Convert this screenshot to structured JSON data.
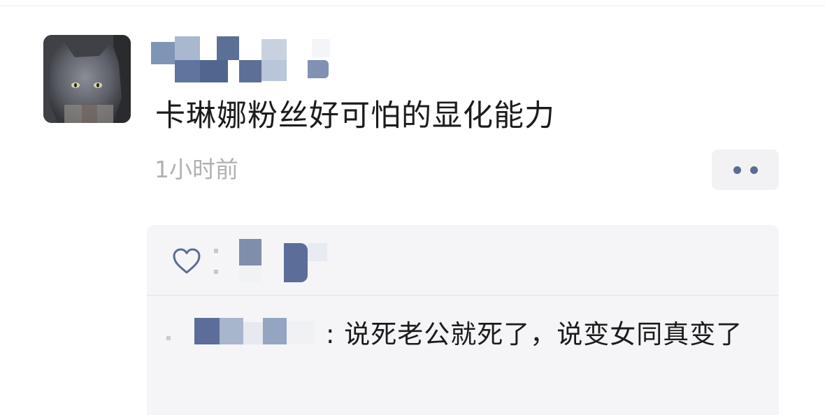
{
  "post": {
    "author_name": "",
    "text": "卡琳娜粉丝好可怕的显化能力",
    "timestamp": "1小时前"
  },
  "more_button": {
    "icon": "more-dots-icon"
  },
  "interactions": {
    "like_icon": "heart-outline-icon",
    "comments": [
      {
        "author": "",
        "separator": ":",
        "text": "说死老公就死了，说变女同真变了"
      }
    ]
  },
  "colors": {
    "text_primary": "#1b1b1b",
    "text_secondary": "#b1b1b1",
    "link_blue": "#5a6c92",
    "panel_bg": "#f5f5f7"
  }
}
